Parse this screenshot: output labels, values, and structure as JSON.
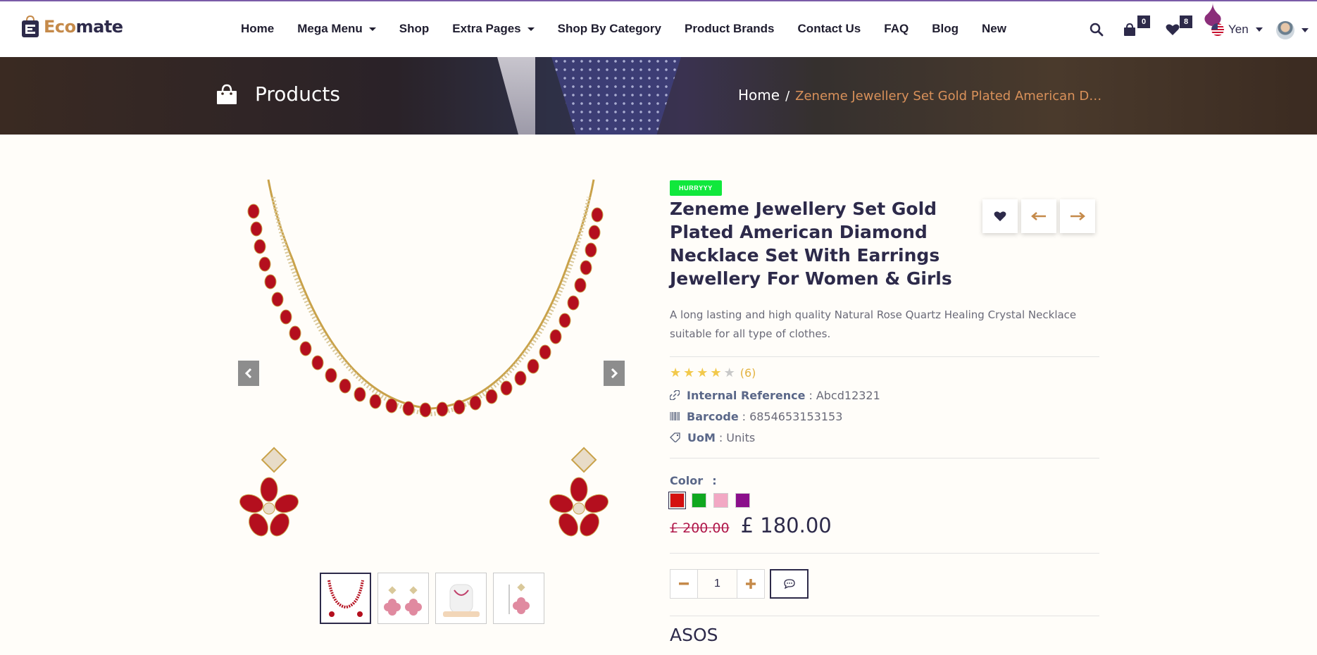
{
  "brand": {
    "logo_part1": "Eco",
    "logo_part2": "mate",
    "accent": "#c58a4a",
    "primary": "#2d2a4a"
  },
  "nav": [
    {
      "label": "Home",
      "dropdown": false
    },
    {
      "label": "Mega Menu",
      "dropdown": true
    },
    {
      "label": "Shop",
      "dropdown": false
    },
    {
      "label": "Extra Pages",
      "dropdown": true
    },
    {
      "label": "Shop By Category",
      "dropdown": false
    },
    {
      "label": "Product Brands",
      "dropdown": false
    },
    {
      "label": "Contact Us",
      "dropdown": false
    },
    {
      "label": "FAQ",
      "dropdown": false
    },
    {
      "label": "Blog",
      "dropdown": false
    },
    {
      "label": "New",
      "dropdown": false
    }
  ],
  "header": {
    "cart_count": "0",
    "wishlist_count": "8",
    "currency": "Yen"
  },
  "banner": {
    "title": "Products",
    "breadcrumb_home": "Home",
    "breadcrumb_sep": "/",
    "breadcrumb_current": "Zeneme Jewellery Set Gold Plated American Diamond Necklace Set With Earrings Jewellery For Women & Girls"
  },
  "product": {
    "ribbon": "HURRYYY",
    "title": "Zeneme Jewellery Set Gold Plated American Diamond Necklace Set With Earrings Jewellery For Women & Girls",
    "description": "A long lasting and high quality Natural Rose Quartz Healing Crystal Necklace suitable for all type of clothes.",
    "rating": 4,
    "rating_max": 5,
    "review_count": "(6)",
    "internal_ref_label": "Internal Reference",
    "internal_ref_value": "Abcd12321",
    "barcode_label": "Barcode",
    "barcode_value": "6854653153153",
    "uom_label": "UoM",
    "uom_value": "Units",
    "separator": ":",
    "color_label": "Color",
    "color_sep": ":",
    "colors": [
      "#d41010",
      "#10a820",
      "#f2a8c4",
      "#8b0f8b"
    ],
    "old_price": "£ 200.00",
    "price": "£ 180.00",
    "quantity": "1",
    "brand_name": "ASOS"
  },
  "gallery": {
    "thumbnail_count": 4,
    "active_thumbnail": 1
  }
}
